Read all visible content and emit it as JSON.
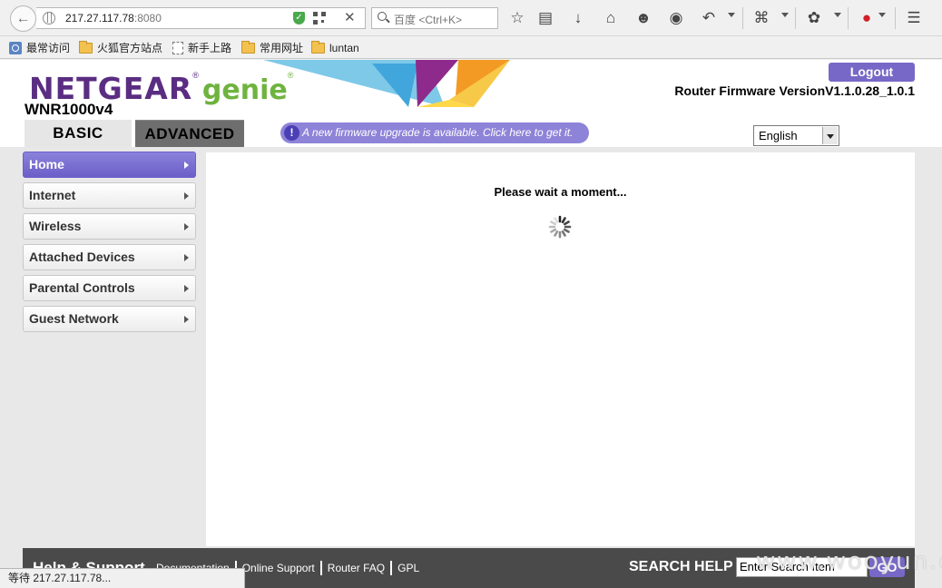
{
  "browser": {
    "url_host": "217.27.117.78",
    "url_port": ":8080",
    "search_placeholder": "百度 <Ctrl+K>",
    "bookmarks": [
      "最常访问",
      "火狐官方站点",
      "新手上路",
      "常用网址",
      "luntan"
    ],
    "status_text": "等待 217.27.117.78..."
  },
  "header": {
    "brand": "NETGEAR",
    "brand_reg": "®",
    "product": "genie",
    "product_reg": "®",
    "model": "WNR1000v4",
    "logout_label": "Logout",
    "firmware_version": "Router Firmware VersionV1.1.0.28_1.0.1",
    "tabs": {
      "basic": "BASIC",
      "advanced": "ADVANCED"
    },
    "firmware_alert": "A new firmware upgrade is available. Click here to get it.",
    "language": "English"
  },
  "sidebar": {
    "items": [
      {
        "label": "Home",
        "active": true
      },
      {
        "label": "Internet",
        "active": false
      },
      {
        "label": "Wireless",
        "active": false
      },
      {
        "label": "Attached Devices",
        "active": false
      },
      {
        "label": "Parental Controls",
        "active": false
      },
      {
        "label": "Guest Network",
        "active": false
      }
    ]
  },
  "main": {
    "wait_message": "Please wait a moment..."
  },
  "footer": {
    "title": "Help & Support",
    "links": [
      "Documentation",
      "Online Support",
      "Router FAQ",
      "GPL"
    ],
    "search_label": "SEARCH HELP",
    "search_placeholder": "Enter Search Item",
    "go_label": "GO"
  },
  "watermark": "www.wooyun.org",
  "colors": {
    "netgear_purple": "#5a2d82",
    "genie_green": "#6fb33f",
    "accent": "#7768c7"
  }
}
